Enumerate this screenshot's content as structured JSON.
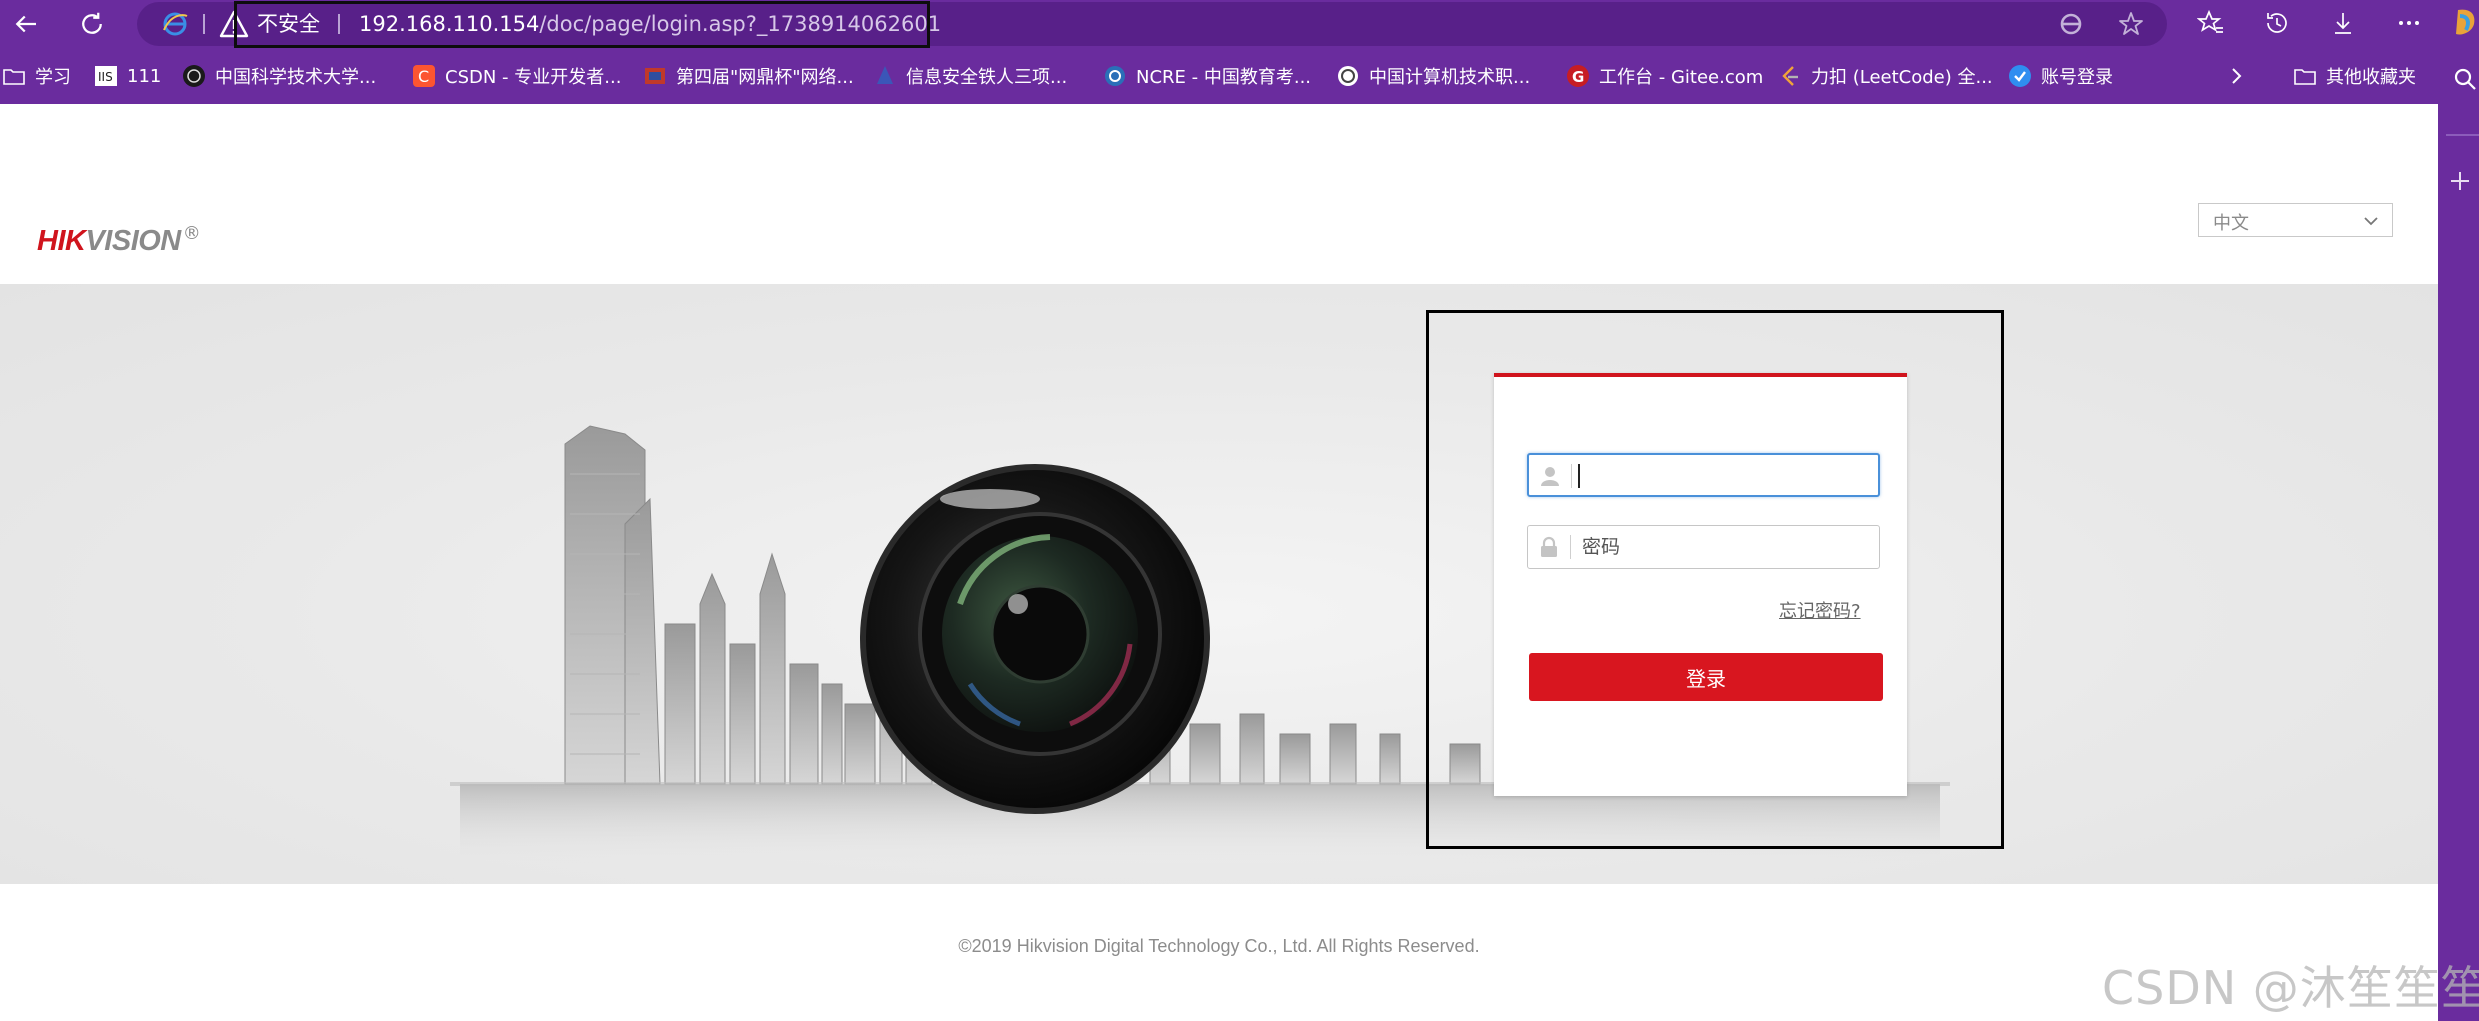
{
  "browser": {
    "insecure_label": "不安全",
    "url_host": "192.168.110.154",
    "url_path": "/doc/page/login.asp?_1738914062601",
    "accent": "#6a2c9e"
  },
  "bookmarks": [
    {
      "label": "学习",
      "icon": "folder-icon"
    },
    {
      "label": "111",
      "icon": "site-icon"
    },
    {
      "label": "中国科学技术大学...",
      "icon": "site-icon"
    },
    {
      "label": "CSDN - 专业开发者...",
      "icon": "csdn-icon"
    },
    {
      "label": "第四届\"网鼎杯\"网络...",
      "icon": "site-icon"
    },
    {
      "label": "信息安全铁人三项...",
      "icon": "site-icon"
    },
    {
      "label": "NCRE - 中国教育考...",
      "icon": "site-icon"
    },
    {
      "label": "中国计算机技术职...",
      "icon": "site-icon"
    },
    {
      "label": "工作台 - Gitee.com",
      "icon": "gitee-icon"
    },
    {
      "label": "力扣 (LeetCode) 全...",
      "icon": "leetcode-icon"
    },
    {
      "label": "账号登录",
      "icon": "site-icon"
    }
  ],
  "other_favorites": "其他收藏夹",
  "page": {
    "logo_hik": "HIK",
    "logo_vision": "VISION",
    "logo_reg": "®",
    "language": "中文",
    "login": {
      "username_value": "",
      "password_placeholder": "密码",
      "forgot_password": "忘记密码?",
      "login_button": "登录"
    },
    "footer": "©2019 Hikvision Digital Technology Co., Ltd. All Rights Reserved.",
    "brand_color": "#d0141d"
  },
  "watermark": "CSDN @沐笙笙笙"
}
